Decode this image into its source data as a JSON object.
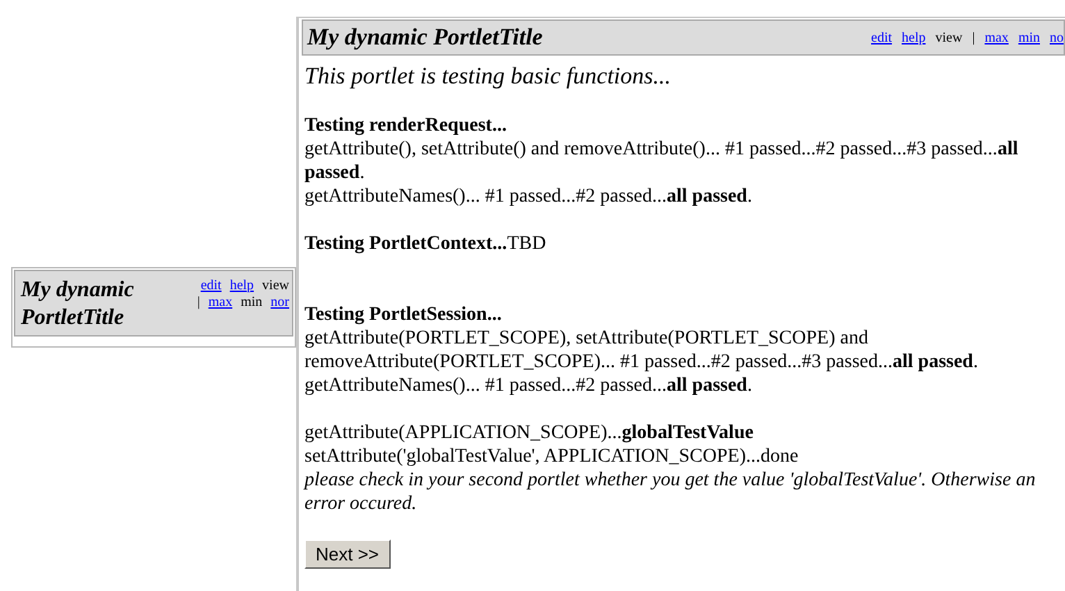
{
  "portlets": [
    {
      "title": "My dynamic PortletTitle",
      "controls": [
        {
          "kind": "link",
          "label": "edit",
          "selected": false
        },
        {
          "kind": "link",
          "label": "help",
          "selected": false
        },
        {
          "kind": "link",
          "label": "view",
          "selected": true
        },
        {
          "kind": "separator",
          "label": "|"
        },
        {
          "kind": "link",
          "label": "max",
          "selected": false
        },
        {
          "kind": "link",
          "label": "min",
          "selected": true
        },
        {
          "kind": "link",
          "label": "nor",
          "selected": false
        }
      ]
    },
    {
      "title": "My dynamic PortletTitle",
      "controls": [
        {
          "kind": "link",
          "label": "edit",
          "selected": false
        },
        {
          "kind": "link",
          "label": "help",
          "selected": false
        },
        {
          "kind": "link",
          "label": "view",
          "selected": true
        },
        {
          "kind": "separator",
          "label": "|"
        },
        {
          "kind": "link",
          "label": "max",
          "selected": false
        },
        {
          "kind": "link",
          "label": "min",
          "selected": false
        },
        {
          "kind": "link",
          "label": "no",
          "selected": false
        }
      ],
      "intro": "This portlet is testing basic functions...",
      "sections": [
        {
          "lines": [
            {
              "kind": "heading",
              "text": "Testing renderRequest..."
            },
            {
              "kind": "text",
              "text": "getAttribute(), setAttribute() and removeAttribute()... #1 passed...#2 passed...#3 passed...**all passed**."
            },
            {
              "kind": "text",
              "text": "getAttributeNames()... #1 passed...#2 passed...**all passed**."
            }
          ]
        },
        {
          "lines": [
            {
              "kind": "text",
              "text": "**Testing PortletContext...**TBD"
            }
          ]
        },
        {
          "lines": [
            {
              "kind": "heading",
              "text": "Testing PortletSession..."
            },
            {
              "kind": "text",
              "text": "getAttribute(PORTLET_SCOPE), setAttribute(PORTLET_SCOPE) and"
            },
            {
              "kind": "text",
              "text": "removeAttribute(PORTLET_SCOPE)... #1 passed...#2 passed...#3 passed...**all passed**."
            },
            {
              "kind": "text",
              "text": "getAttributeNames()... #1 passed...#2 passed...**all passed**."
            }
          ]
        },
        {
          "lines": [
            {
              "kind": "text",
              "text": "getAttribute(APPLICATION_SCOPE)...**globalTestValue**"
            },
            {
              "kind": "text",
              "text": "setAttribute('globalTestValue', APPLICATION_SCOPE)...done"
            },
            {
              "kind": "note",
              "text": "please check in your second portlet whether you get the value 'globalTestValue'. Otherwise an error occured."
            }
          ]
        }
      ],
      "button": "Next >>"
    }
  ]
}
